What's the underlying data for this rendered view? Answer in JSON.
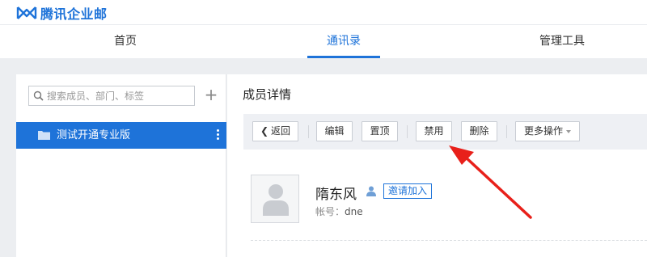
{
  "app": {
    "name": "腾讯企业邮"
  },
  "nav": {
    "tabs": [
      {
        "label": "首页"
      },
      {
        "label": "通讯录"
      },
      {
        "label": "管理工具"
      }
    ],
    "active_index": 1
  },
  "sidebar": {
    "search_placeholder": "搜索成员、部门、标签",
    "departments": [
      {
        "label": "测试开通专业版",
        "selected": true
      }
    ]
  },
  "main": {
    "title": "成员详情",
    "toolbar": {
      "back": "返回",
      "edit": "编辑",
      "pin": "置顶",
      "disable": "禁用",
      "delete": "删除",
      "more": "更多操作"
    },
    "member": {
      "name": "隋东风",
      "invite": "邀请加入",
      "account_label": "帐号：",
      "account_value": "dne"
    }
  },
  "colors": {
    "accent": "#1e73d9",
    "annotation_arrow": "#e8201a"
  }
}
